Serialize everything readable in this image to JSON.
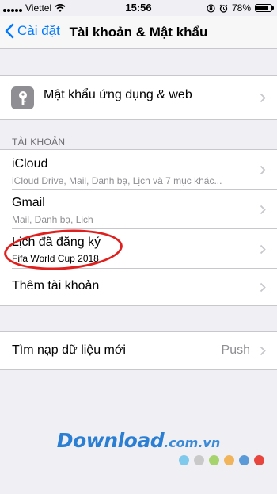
{
  "status_bar": {
    "carrier": "Viettel",
    "time": "15:56",
    "battery": "78%",
    "battery_level": 0.78
  },
  "nav": {
    "back_label": "Cài đặt",
    "title": "Tài khoản & Mật khẩu"
  },
  "passwords": {
    "label": "Mật khẩu ứng dụng & web",
    "icon": "key-icon"
  },
  "accounts": {
    "header": "TÀI KHOẢN",
    "items": [
      {
        "title": "iCloud",
        "subtitle": "iCloud Drive, Mail, Danh bạ, Lịch và 7 mục khác..."
      },
      {
        "title": "Gmail",
        "subtitle": "Mail, Danh bạ, Lịch"
      },
      {
        "title": "Lịch đã đăng ký",
        "subtitle": "Fifa World Cup 2018"
      },
      {
        "title": "Thêm tài khoản",
        "subtitle": ""
      }
    ]
  },
  "fetch": {
    "label": "Tìm nạp dữ liệu mới",
    "value": "Push"
  },
  "watermark": {
    "main": "Download",
    "suffix": ".com.vn",
    "dot_colors": [
      "#7fc9ec",
      "#c9c9c9",
      "#a6d36b",
      "#f2b45a",
      "#5b9ad9",
      "#e8453c"
    ]
  },
  "colors": {
    "accent": "#007aff",
    "highlight_circle": "#e0201e"
  }
}
